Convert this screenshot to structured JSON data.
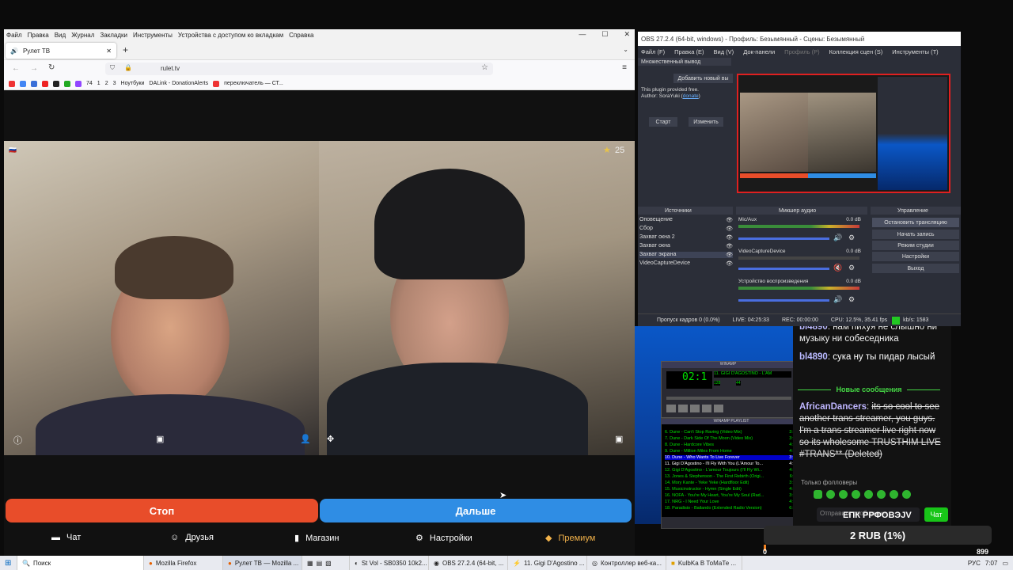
{
  "firefox": {
    "menu": [
      "Файл",
      "Правка",
      "Вид",
      "Журнал",
      "Закладки",
      "Инструменты",
      "Устройства с доступом ко вкладкам",
      "Справка"
    ],
    "tab_title": "Рулет ТВ",
    "url": "rulet.tv",
    "bookmarks": [
      "74",
      "1",
      "2",
      "3",
      "Ноутбуки",
      "DALink - DonationAlerts",
      "переключатель — СТ..."
    ]
  },
  "video": {
    "star_count": "25"
  },
  "buttons": {
    "stop": "Стоп",
    "next": "Дальше"
  },
  "bottom_nav": [
    "Чат",
    "Друзья",
    "Магазин",
    "Настройки",
    "Премиум"
  ],
  "obs": {
    "title": "OBS 27.2.4 (64-bit, windows) - Профиль: Безымянный - Сцены: Безымянный",
    "menu": [
      "Файл (F)",
      "Правка (E)",
      "Вид (V)",
      "Док-панели",
      "Профиль (P)",
      "Коллекция сцен (S)",
      "Инструменты (T)"
    ],
    "multi_output": "Множественный вывод",
    "add_new": "Добавить новый вы",
    "plugin_text": "This plugin provided free.",
    "author": "Author: SoraYuki",
    "donate": "donate",
    "start": "Старт",
    "change": "Изменить",
    "sources_title": "Источники",
    "mixer_title": "Микшер аудио",
    "controls_title": "Управление",
    "sources": [
      "Оповещение",
      "Сбор",
      "Захват окна 2",
      "Захват окна",
      "Захват экрана",
      "VideoCaptureDevice"
    ],
    "mixer": [
      {
        "name": "Mic/Aux",
        "db": "0.0 dB"
      },
      {
        "name": "VideoCaptureDevice",
        "db": "0.0 dB"
      },
      {
        "name": "Устройство воспроизведения",
        "db": "0.0 dB"
      }
    ],
    "controls": [
      "Остановить трансляцию",
      "Начать запись",
      "Режим студии",
      "Настройки",
      "Выход"
    ],
    "status": {
      "dropped": "Пропуск кадров 0 (0.0%)",
      "live": "LIVE: 04:25:33",
      "rec": "REC: 00:00:00",
      "cpu": "CPU: 12.5%, 35.41 fps",
      "kbps": "kb/s: 1583"
    }
  },
  "winamp": {
    "time": "02:1",
    "title_scroll": "11. GIGI D'AGOSTINO - L'AM",
    "kbps": "128",
    "khz": "44",
    "header": "WINAMP",
    "playlist_header": "WINAMP PLAYLIST",
    "playlist": [
      {
        "t": "6. Dune - Can't Stop Raving (Video Mix)",
        "d": "3:36"
      },
      {
        "t": "7. Dune - Dark Side Of The Moon (Video Mix)",
        "d": "3:18"
      },
      {
        "t": "8. Dune - Hardcore Vibes",
        "d": "4:50"
      },
      {
        "t": "9. Dune - Million Miles From Home",
        "d": "4:23"
      },
      {
        "t": "10. Dune - Who Wants To Live Forever",
        "d": "3:54"
      },
      {
        "t": "11. Gigi D'Agostino - I'll Fly With You (L'Amour To...",
        "d": "4:05"
      },
      {
        "t": "12. Gigi D'Agostino - L'amour Toujours (I'll Fly Wi...",
        "d": "4:03"
      },
      {
        "t": "13. Jones & Stephenson - The First Rebirth (Origi...",
        "d": "6:11"
      },
      {
        "t": "14. Mory Kante - Yeke Yeke (Hardfloor Edit)",
        "d": "3:55"
      },
      {
        "t": "15. Musicinstructor - Hymn (Single Edit)",
        "d": "4:05"
      },
      {
        "t": "16. NOFA - You're My Heart, You're My Soul (Rad...",
        "d": "3:38"
      },
      {
        "t": "17. NRG - I Need Your Love",
        "d": "4:04"
      },
      {
        "t": "18. Paradisio - Bailando (Extended Radio Version)",
        "d": "6:48"
      }
    ]
  },
  "chat": {
    "lines": [
      {
        "user": "bl4890",
        "text": "нам пихуя не слышно ни музыку ни собеседника"
      },
      {
        "user": "bl4890",
        "text": "сука ну ты пидар лысый"
      }
    ],
    "new_messages": "Новые сообщения",
    "deleted_user": "AfricanDancers",
    "deleted_text": "its so cool to see another trans streamer, you guys. I'm a trans streamer live right now so its wholesome TRUSTHIM LIVE #TRANS** (Deleted)",
    "followers": "Только фолловеры",
    "input_placeholder": "Отправить сообщение",
    "send": "Чат",
    "overlay_code": "ЕПК РРФОВЭЈV",
    "donation": "2 RUB (1%)",
    "corner_number": "899",
    "zero": "0"
  },
  "taskbar": {
    "search": "Поиск",
    "items": [
      "Mozilla Firefox",
      "Рулет ТВ — Mozilla ...",
      "St Vol - SB0350 10k2...",
      "OBS 27.2.4 (64-bit, ...",
      "11. Gigi D'Agostino ...",
      "Контроллер веб-ка...",
      "KulbKa В ТоМаТе ..."
    ],
    "lang": "РУС",
    "time": "7:07"
  }
}
